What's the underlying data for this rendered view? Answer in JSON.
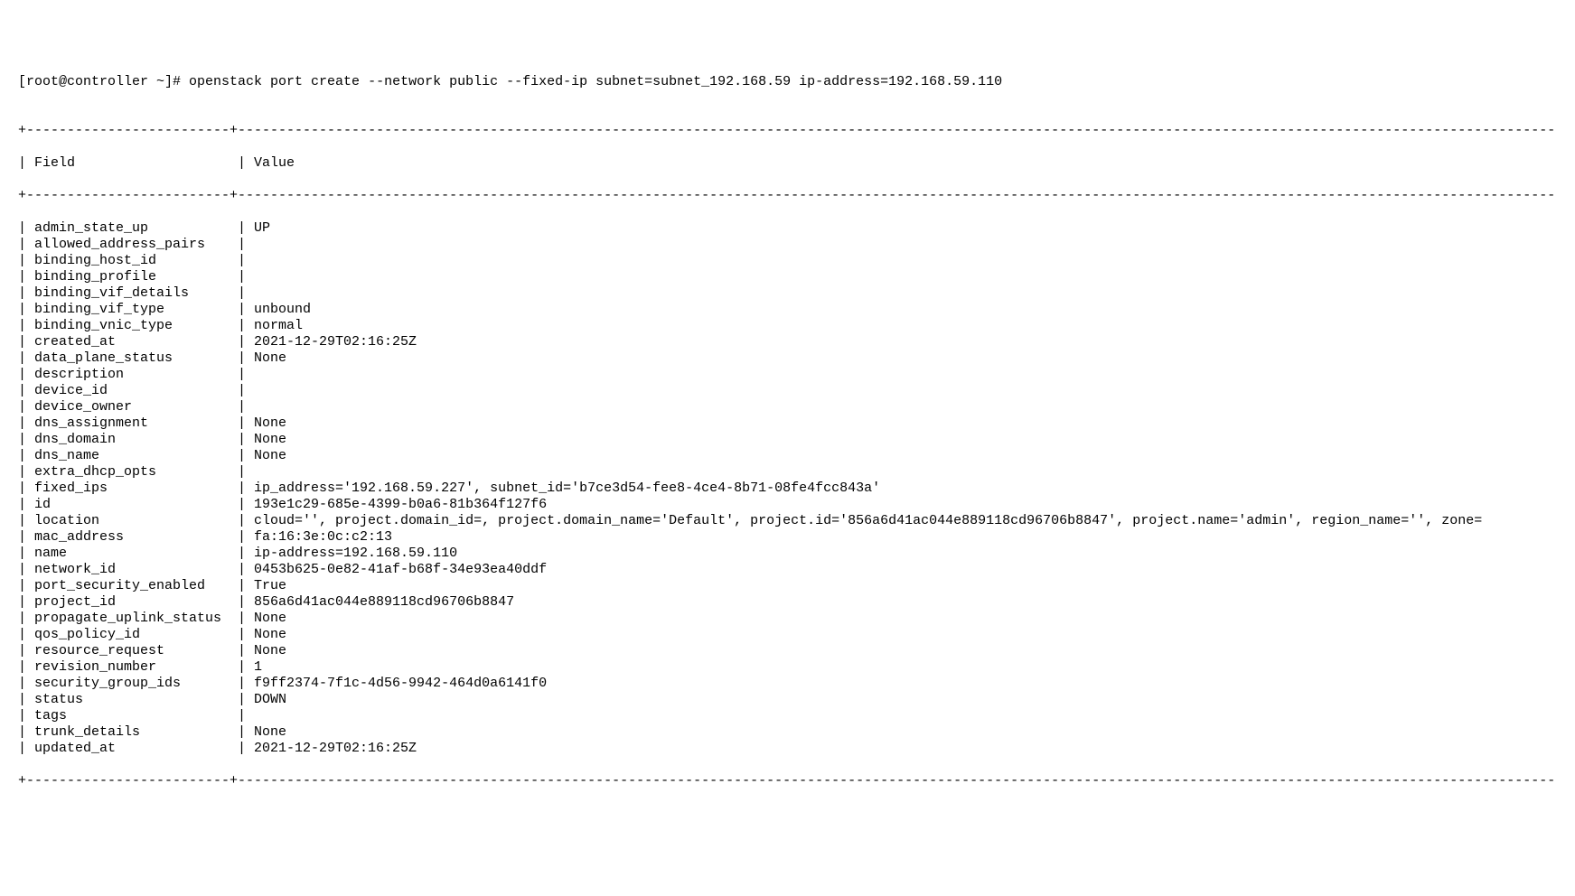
{
  "prompt": "[root@controller ~]# ",
  "command": "openstack port create --network public --fixed-ip subnet=subnet_192.168.59 ip-address=192.168.59.110",
  "header": {
    "field": "Field",
    "value": "Value"
  },
  "rows": [
    {
      "field": "admin_state_up",
      "value": "UP"
    },
    {
      "field": "allowed_address_pairs",
      "value": ""
    },
    {
      "field": "binding_host_id",
      "value": ""
    },
    {
      "field": "binding_profile",
      "value": ""
    },
    {
      "field": "binding_vif_details",
      "value": ""
    },
    {
      "field": "binding_vif_type",
      "value": "unbound"
    },
    {
      "field": "binding_vnic_type",
      "value": "normal"
    },
    {
      "field": "created_at",
      "value": "2021-12-29T02:16:25Z"
    },
    {
      "field": "data_plane_status",
      "value": "None"
    },
    {
      "field": "description",
      "value": ""
    },
    {
      "field": "device_id",
      "value": ""
    },
    {
      "field": "device_owner",
      "value": ""
    },
    {
      "field": "dns_assignment",
      "value": "None"
    },
    {
      "field": "dns_domain",
      "value": "None"
    },
    {
      "field": "dns_name",
      "value": "None"
    },
    {
      "field": "extra_dhcp_opts",
      "value": ""
    },
    {
      "field": "fixed_ips",
      "value": "ip_address='192.168.59.227', subnet_id='b7ce3d54-fee8-4ce4-8b71-08fe4fcc843a'"
    },
    {
      "field": "id",
      "value": "193e1c29-685e-4399-b0a6-81b364f127f6"
    },
    {
      "field": "location",
      "value": "cloud='', project.domain_id=, project.domain_name='Default', project.id='856a6d41ac044e889118cd96706b8847', project.name='admin', region_name='', zone="
    },
    {
      "field": "mac_address",
      "value": "fa:16:3e:0c:c2:13"
    },
    {
      "field": "name",
      "value": "ip-address=192.168.59.110"
    },
    {
      "field": "network_id",
      "value": "0453b625-0e82-41af-b68f-34e93ea40ddf"
    },
    {
      "field": "port_security_enabled",
      "value": "True"
    },
    {
      "field": "project_id",
      "value": "856a6d41ac044e889118cd96706b8847"
    },
    {
      "field": "propagate_uplink_status",
      "value": "None"
    },
    {
      "field": "qos_policy_id",
      "value": "None"
    },
    {
      "field": "resource_request",
      "value": "None"
    },
    {
      "field": "revision_number",
      "value": "1"
    },
    {
      "field": "security_group_ids",
      "value": "f9ff2374-7f1c-4d56-9942-464d0a6141f0"
    },
    {
      "field": "status",
      "value": "DOWN"
    },
    {
      "field": "tags",
      "value": ""
    },
    {
      "field": "trunk_details",
      "value": "None"
    },
    {
      "field": "updated_at",
      "value": "2021-12-29T02:16:25Z"
    }
  ],
  "bars": {
    "top": "+-------------------------+---------------------------------------------------------------------------------------------------------------------------------------------------------------------+",
    "mid": "+-------------------------+---------------------------------------------------------------------------------------------------------------------------------------------------------------------+",
    "bottom": "+-------------------------+---------------------------------------------------------------------------------------------------------------------------------------------------------------------+"
  }
}
